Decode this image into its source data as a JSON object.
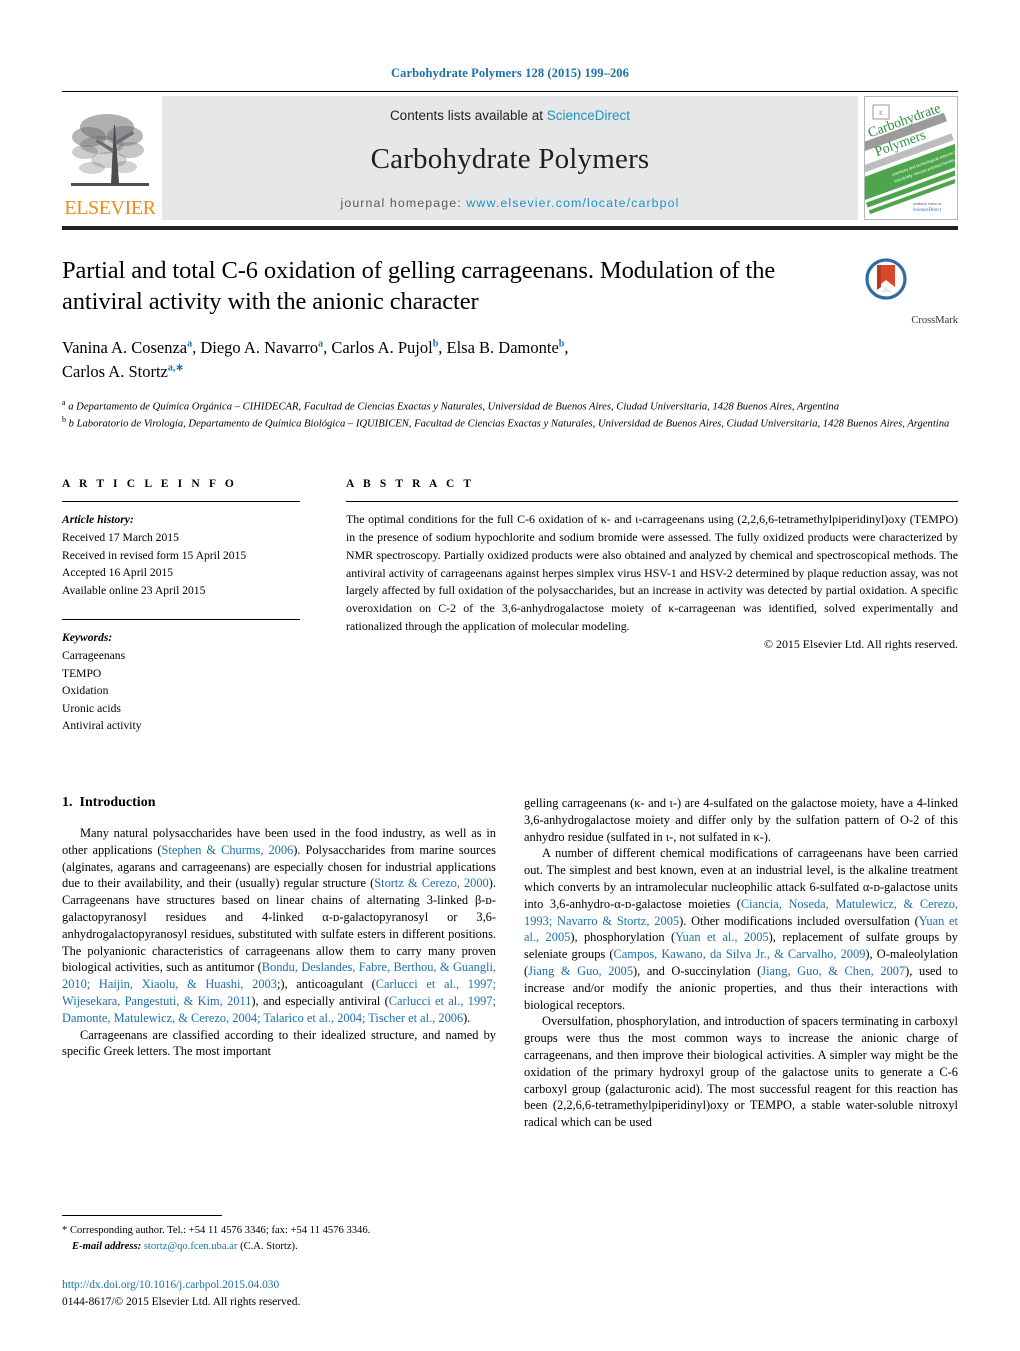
{
  "running_head": "Carbohydrate Polymers 128 (2015) 199–206",
  "banner": {
    "contents_prefix": "Contents lists available at ",
    "sciencedirect": "ScienceDirect",
    "journal_name": "Carbohydrate Polymers",
    "homepage_prefix": "journal homepage: ",
    "homepage_url": "www.elsevier.com/locate/carbpol",
    "elsevier_wordmark": "ELSEVIER",
    "cover_title_line1": "Carbohydrate",
    "cover_title_line2": "Polymers",
    "link_color": "#1b93c8"
  },
  "article": {
    "title": "Partial and total C-6 oxidation of gelling carrageenans. Modulation of the antiviral activity with the anionic character",
    "crossmark_label": "CrossMark",
    "authors_line1": "Vanina A. Cosenza a, Diego A. Navarro a, Carlos A. Pujol b, Elsa B. Damonte b,",
    "authors_line2": "Carlos A. Stortz a,*",
    "affiliation_a": "a Departamento de Química Orgánica – CIHIDECAR, Facultad de Ciencias Exactas y Naturales, Universidad de Buenos Aires, Ciudad Universitaria, 1428 Buenos Aires, Argentina",
    "affiliation_b": "b Laboratorio de Virología, Departamento de Química Biológica – IQUIBICEN, Facultad de Ciencias Exactas y Naturales, Universidad de Buenos Aires, Ciudad Universitaria, 1428 Buenos Aires, Argentina"
  },
  "article_info": {
    "heading": "A R T I C L E   I N F O",
    "history_label": "Article history:",
    "history": [
      "Received 17 March 2015",
      "Received in revised form 15 April 2015",
      "Accepted 16 April 2015",
      "Available online 23 April 2015"
    ],
    "keywords_label": "Keywords:",
    "keywords": [
      "Carrageenans",
      "TEMPO",
      "Oxidation",
      "Uronic acids",
      "Antiviral activity"
    ]
  },
  "abstract": {
    "heading": "A B S T R A C T",
    "text": "The optimal conditions for the full C-6 oxidation of κ- and ι-carrageenans using (2,2,6,6-tetramethylpiperidinyl)oxy (TEMPO) in the presence of sodium hypochlorite and sodium bromide were assessed. The fully oxidized products were characterized by NMR spectroscopy. Partially oxidized products were also obtained and analyzed by chemical and spectroscopical methods. The antiviral activity of carrageenans against herpes simplex virus HSV-1 and HSV-2 determined by plaque reduction assay, was not largely affected by full oxidation of the polysaccharides, but an increase in activity was detected by partial oxidation. A specific overoxidation on C-2 of the 3,6-anhydrogalactose moiety of κ-carrageenan was identified, solved experimentally and rationalized through the application of molecular modeling.",
    "copyright": "© 2015 Elsevier Ltd. All rights reserved."
  },
  "introduction": {
    "section_number": "1.",
    "section_title": "Introduction",
    "left_paragraphs": [
      {
        "segments": [
          {
            "t": "Many natural polysaccharides have been used in the food industry, as well as in other applications (",
            "link": false
          },
          {
            "t": "Stephen & Churms, 2006",
            "link": true
          },
          {
            "t": "). Polysaccharides from marine sources (alginates, agarans and carrageenans) are especially chosen for industrial applications due to their availability, and their (usually) regular structure (",
            "link": false
          },
          {
            "t": "Stortz & Cerezo, 2000",
            "link": true
          },
          {
            "t": "). Carrageenans have structures based on linear chains of alternating 3-linked β-ᴅ-galactopyranosyl residues and 4-linked α-ᴅ-galactopyranosyl or 3,6-anhydrogalactopyranosyl residues, substituted with sulfate esters in different positions. The polyanionic characteristics of carrageenans allow them to carry many proven biological activities, such as antitumor (",
            "link": false
          },
          {
            "t": "Bondu, Deslandes, Fabre, Berthou, & Guangli, 2010; Haijin, Xiaolu, & Huashi, 2003",
            "link": true
          },
          {
            "t": ";), anticoagulant (",
            "link": false
          },
          {
            "t": "Carlucci et al., 1997; Wijesekara, Pangestuti, & Kim, 2011",
            "link": true
          },
          {
            "t": "), and especially antiviral (",
            "link": false
          },
          {
            "t": "Carlucci et al., 1997; Damonte, Matulewicz, & Cerezo, 2004; Talarico et al., 2004; Tischer et al., 2006",
            "link": true
          },
          {
            "t": ").",
            "link": false
          }
        ]
      },
      {
        "segments": [
          {
            "t": "Carrageenans are classified according to their idealized structure, and named by specific Greek letters. The most important",
            "link": false
          }
        ]
      }
    ],
    "right_paragraphs": [
      {
        "no_indent": true,
        "segments": [
          {
            "t": "gelling carrageenans (κ- and ι-) are 4-sulfated on the galactose moiety, have a 4-linked 3,6-anhydrogalactose moiety and differ only by the sulfation pattern of O-2 of this anhydro residue (sulfated in ι-, not sulfated in κ-).",
            "link": false
          }
        ]
      },
      {
        "segments": [
          {
            "t": "A number of different chemical modifications of carrageenans have been carried out. The simplest and best known, even at an industrial level, is the alkaline treatment which converts by an intramolecular nucleophilic attack 6-sulfated α-ᴅ-galactose units into 3,6-anhydro-α-ᴅ-galactose moieties (",
            "link": false
          },
          {
            "t": "Ciancia, Noseda, Matulewicz, & Cerezo, 1993; Navarro & Stortz, 2005",
            "link": true
          },
          {
            "t": "). Other modifications included oversulfation (",
            "link": false
          },
          {
            "t": "Yuan et al., 2005",
            "link": true
          },
          {
            "t": "), phosphorylation (",
            "link": false
          },
          {
            "t": "Yuan et al., 2005",
            "link": true
          },
          {
            "t": "), replacement of sulfate groups by seleniate groups (",
            "link": false
          },
          {
            "t": "Campos, Kawano, da Silva Jr., & Carvalho, 2009",
            "link": true
          },
          {
            "t": "), O-maleolylation (",
            "link": false
          },
          {
            "t": "Jiang & Guo, 2005",
            "link": true
          },
          {
            "t": "), and O-succinylation (",
            "link": false
          },
          {
            "t": "Jiang, Guo, & Chen, 2007",
            "link": true
          },
          {
            "t": "), used to increase and/or modify the anionic properties, and thus their interactions with biological receptors.",
            "link": false
          }
        ]
      },
      {
        "segments": [
          {
            "t": "Oversulfation, phosphorylation, and introduction of spacers terminating in carboxyl groups were thus the most common ways to increase the anionic charge of carrageenans, and then improve their biological activities. A simpler way might be the oxidation of the primary hydroxyl group of the galactose units to generate a C-6 carboxyl group (galacturonic acid). The most successful reagent for this reaction has been (2,2,6,6-tetramethylpiperidinyl)oxy or TEMPO, a stable water-soluble nitroxyl radical which can be used",
            "link": false
          }
        ]
      }
    ]
  },
  "footnote": {
    "corresponding": "* Corresponding author. Tel.: +54 11 4576 3346; fax: +54 11 4576 3346.",
    "email_label": "E-mail address:",
    "email": "stortz@qo.fcen.uba.ar",
    "email_suffix": "(C.A. Stortz)."
  },
  "doi": {
    "url": "http://dx.doi.org/10.1016/j.carbpol.2015.04.030",
    "issn_line": "0144-8617/© 2015 Elsevier Ltd. All rights reserved."
  }
}
